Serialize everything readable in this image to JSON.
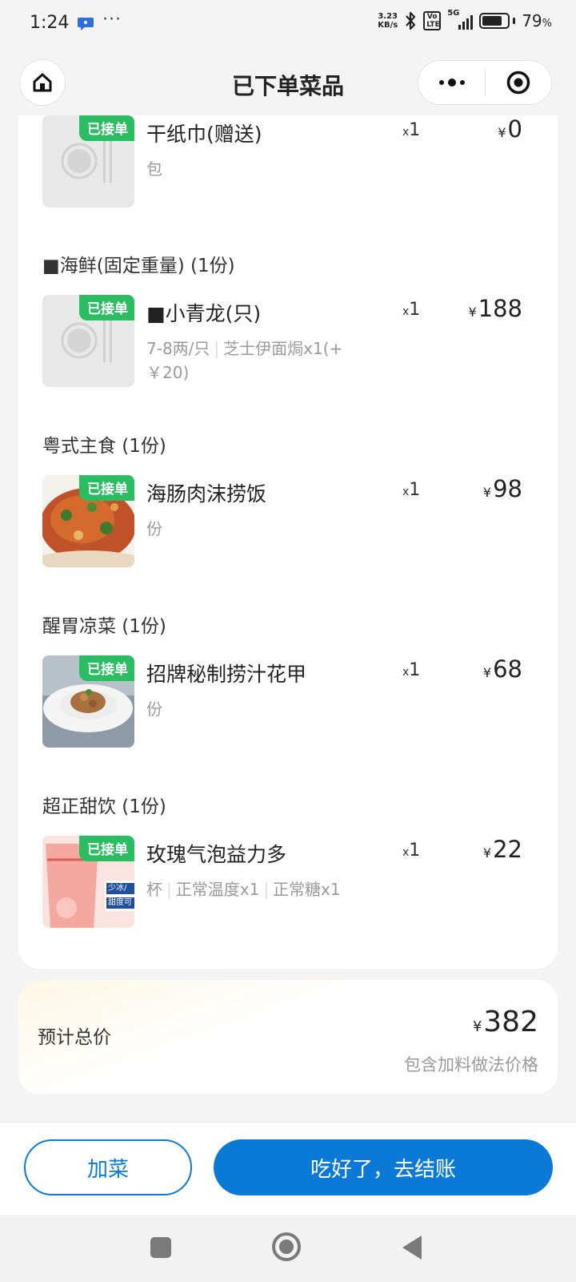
{
  "status_bar": {
    "time": "1:24",
    "more": "···",
    "net_speed_value": "3.23",
    "net_speed_unit": "KB/s",
    "volte": "Vo LTE",
    "signal_label": "5G",
    "battery_percent": "79",
    "battery_percent_sign": "%",
    "battery_level": 0.79,
    "icons": [
      "message-icon",
      "bluetooth-icon",
      "signal-icon",
      "battery-icon"
    ]
  },
  "nav": {
    "title": "已下单菜品",
    "icons": [
      "home-icon",
      "more-dots-icon",
      "close-miniprogram-icon"
    ]
  },
  "currency": "¥",
  "qty_prefix": "x",
  "badge": "已接单",
  "items": [
    {
      "name": "干纸巾(赠送)",
      "specs": [
        "包"
      ],
      "qty": "1",
      "price": "0",
      "image": "placeholder-plate-icon"
    },
    {
      "group": "■海鲜(固定重量) (1份)"
    },
    {
      "name": "■小青龙(只)",
      "specs": [
        "7-8两/只",
        "芝士伊面焗x1(+￥20)"
      ],
      "qty": "1",
      "price": "188",
      "image": "placeholder-plate-icon"
    },
    {
      "group": "粤式主食 (1份)"
    },
    {
      "name": "海肠肉沫捞饭",
      "specs": [
        "份"
      ],
      "qty": "1",
      "price": "98",
      "image": "rice-dish-photo"
    },
    {
      "group": "醒胃凉菜 (1份)"
    },
    {
      "name": "招牌秘制捞汁花甲",
      "specs": [
        "份"
      ],
      "qty": "1",
      "price": "68",
      "image": "clam-dish-photo"
    },
    {
      "group": "超正甜饮 (1份)"
    },
    {
      "name": "玫瑰气泡益力多",
      "specs": [
        "杯",
        "正常温度x1",
        "正常糖x1"
      ],
      "qty": "1",
      "price": "22",
      "image": "drink-photo",
      "image_text": [
        "少冰/",
        "甜度可"
      ]
    }
  ],
  "total": {
    "label": "预计总价",
    "price": "382",
    "note": "包含加料做法价格"
  },
  "actions": {
    "add_dish": "加菜",
    "checkout": "吃好了，去结账"
  },
  "colors": {
    "accent": "#0a7ad6",
    "badge": "#2bbd62"
  }
}
